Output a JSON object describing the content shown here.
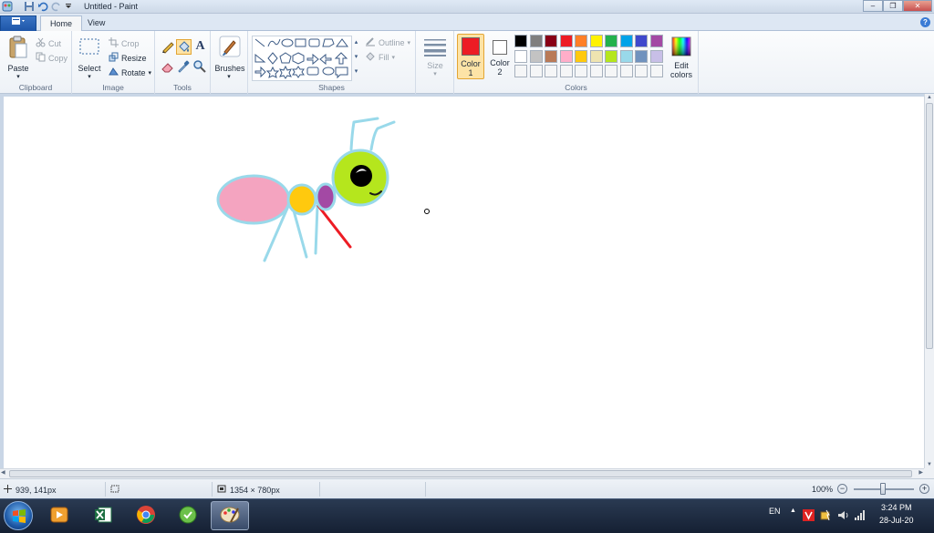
{
  "window": {
    "title": "Untitled - Paint"
  },
  "tabs": {
    "file_label": "",
    "items": [
      {
        "label": "Home",
        "active": true
      },
      {
        "label": "View",
        "active": false
      }
    ]
  },
  "ribbon": {
    "clipboard": {
      "label": "Clipboard",
      "paste": "Paste",
      "cut": "Cut",
      "copy": "Copy"
    },
    "image": {
      "label": "Image",
      "select": "Select",
      "crop": "Crop",
      "resize": "Resize",
      "rotate": "Rotate"
    },
    "tools": {
      "label": "Tools"
    },
    "brushes": {
      "label": "Brushes"
    },
    "shapes": {
      "label": "Shapes",
      "outline": "Outline",
      "fill": "Fill"
    },
    "size": {
      "label": "Size"
    },
    "colors": {
      "label": "Colors",
      "color1_label": "Color",
      "color1_num": "1",
      "color2_label": "Color",
      "color2_num": "2",
      "edit_label": "Edit",
      "edit_label2": "colors",
      "color1_value": "#ed1c24",
      "color2_value": "#ffffff",
      "palette_row1": [
        "#000000",
        "#7f7f7f",
        "#880015",
        "#ed1c24",
        "#ff7f27",
        "#fff200",
        "#22b14c",
        "#00a2e8",
        "#3f48cc",
        "#a349a4"
      ],
      "palette_row2": [
        "#ffffff",
        "#c3c3c3",
        "#b97a57",
        "#ffaec9",
        "#ffc90e",
        "#efe4b0",
        "#b5e61d",
        "#99d9ea",
        "#7092be",
        "#c8bfe7"
      ]
    }
  },
  "status": {
    "cursor_pos": "939, 141px",
    "image_size": "1354 × 780px",
    "zoom": "100%"
  },
  "taskbar": {
    "language": "EN",
    "time": "3:24 PM",
    "date": "28-Jul-20"
  },
  "drawing": {
    "body_fill": "#f4a4c0",
    "outline": "#99d9ea",
    "mid_fill": "#ffc90e",
    "neck_fill": "#a349a4",
    "head_fill": "#b5e61d",
    "leg_red": "#ed1c24"
  }
}
